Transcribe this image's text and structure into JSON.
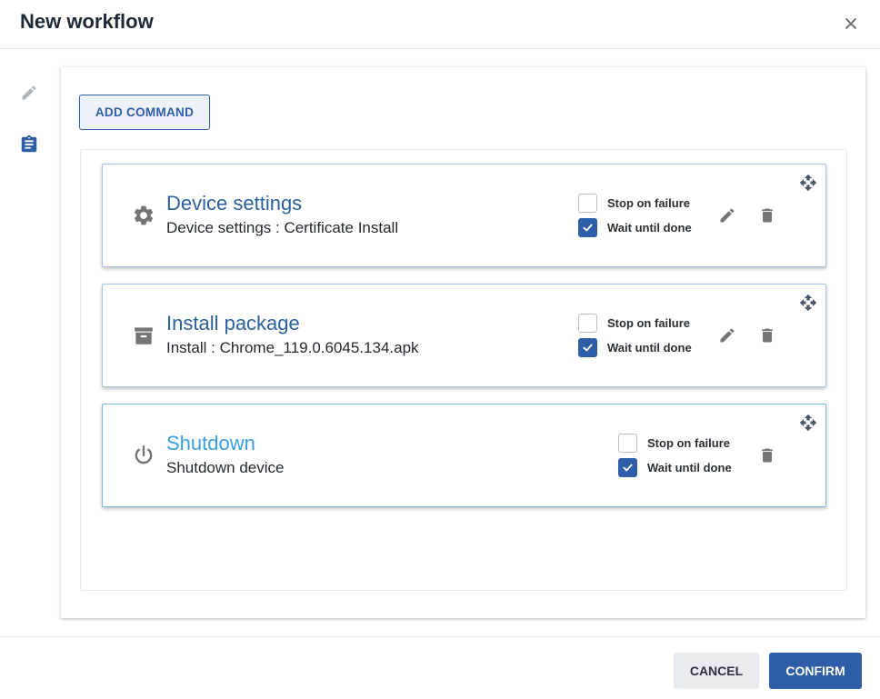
{
  "dialog": {
    "title": "New workflow",
    "close_icon": "close-icon"
  },
  "rail": {
    "items": [
      {
        "icon": "pencil-icon",
        "color": "#b0b5bc"
      },
      {
        "icon": "clipboard-icon",
        "color": "#2f5ea8"
      }
    ]
  },
  "toolbar": {
    "add_command_label": "ADD COMMAND"
  },
  "commands": [
    {
      "title": "Device settings",
      "subtitle": "Device settings : Certificate Install",
      "icon": "gear-icon",
      "stop_on_failure_label": "Stop on failure",
      "stop_on_failure": false,
      "wait_until_done_label": "Wait until done",
      "wait_until_done": true,
      "editable": true
    },
    {
      "title": "Install package",
      "subtitle": "Install : Chrome_119.0.6045.134.apk",
      "icon": "archive-icon",
      "stop_on_failure_label": "Stop on failure",
      "stop_on_failure": false,
      "wait_until_done_label": "Wait until done",
      "wait_until_done": true,
      "editable": true
    },
    {
      "title": "Shutdown",
      "subtitle": "Shutdown device",
      "icon": "power-icon",
      "stop_on_failure_label": "Stop on failure",
      "stop_on_failure": false,
      "wait_until_done_label": "Wait until done",
      "wait_until_done": true,
      "editable": false
    }
  ],
  "footer": {
    "cancel_label": "CANCEL",
    "confirm_label": "CONFIRM"
  },
  "colors": {
    "primary": "#2f5ea8",
    "title_blue": "#2c5f9e",
    "active_title_blue": "#3a9ee0",
    "icon_gray": "#757575"
  }
}
